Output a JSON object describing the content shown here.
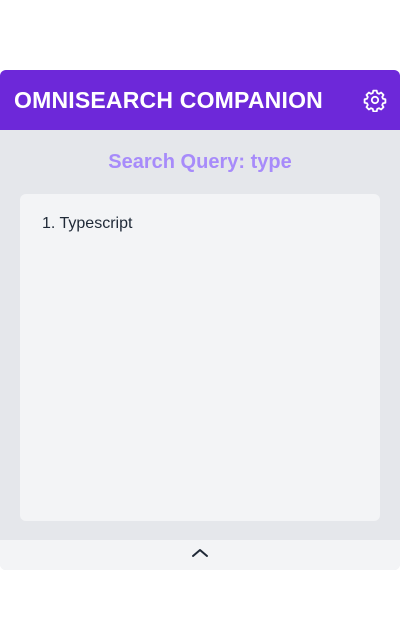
{
  "header": {
    "title": "OMNISEARCH COMPANION",
    "settings_icon": "gear-icon"
  },
  "query": {
    "label": "Search Query: type"
  },
  "results": [
    {
      "label": "1. Typescript"
    }
  ],
  "footer": {
    "toggle_icon": "chevron-up-icon"
  },
  "colors": {
    "header_bg": "#6d28d9",
    "accent_text": "#a78bfa",
    "panel_bg": "#e5e7eb",
    "card_bg": "#f3f4f6"
  }
}
